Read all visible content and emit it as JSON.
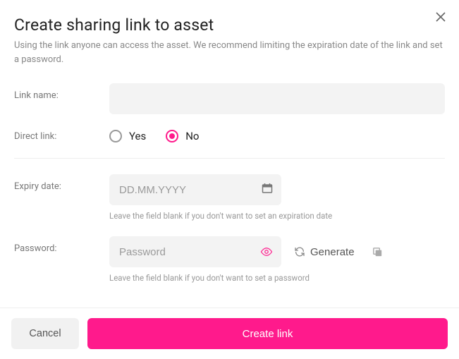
{
  "dialog": {
    "title": "Create sharing link to asset",
    "subtitle": "Using the link anyone can access the asset. We recommend limiting the expiration date of the link and set a password."
  },
  "fields": {
    "link_name": {
      "label": "Link name:",
      "value": ""
    },
    "direct_link": {
      "label": "Direct link:",
      "options": {
        "yes": "Yes",
        "no": "No"
      },
      "selected": "no"
    },
    "expiry": {
      "label": "Expiry date:",
      "placeholder": "DD.MM.YYYY",
      "value": "",
      "hint": "Leave the field blank if you don't want to set an expiration date"
    },
    "password": {
      "label": "Password:",
      "placeholder": "Password",
      "value": "",
      "generate_label": "Generate",
      "hint": "Leave the field blank if you don't want to set a password"
    }
  },
  "footer": {
    "cancel": "Cancel",
    "create": "Create link"
  }
}
